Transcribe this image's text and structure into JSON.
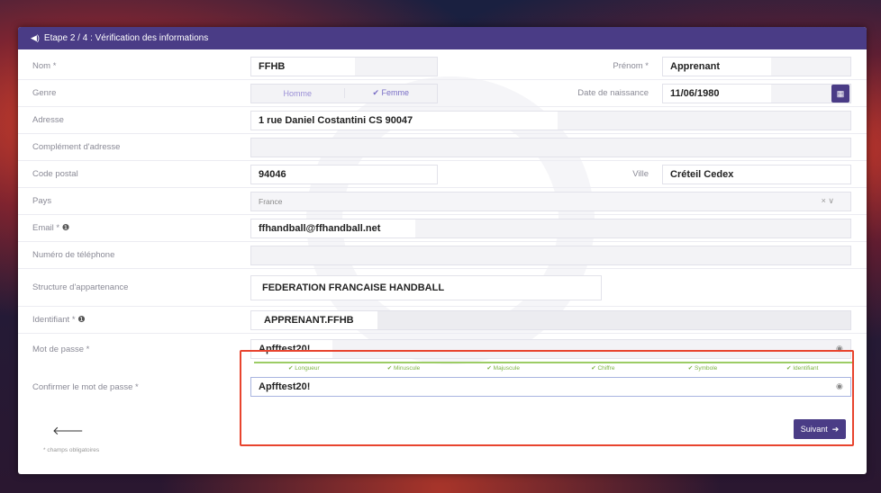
{
  "header": {
    "title": "Etape 2 / 4 : Vérification des informations"
  },
  "fields": {
    "nom": {
      "label": "Nom *",
      "value": "FFHB"
    },
    "prenom": {
      "label": "Prénom *",
      "value": "Apprenant"
    },
    "genre": {
      "label": "Genre",
      "options": [
        "Homme",
        "✔ Femme"
      ]
    },
    "naissance": {
      "label": "Date de naissance",
      "value": "11/06/1980"
    },
    "adresse": {
      "label": "Adresse",
      "value": "1 rue Daniel Costantini CS 90047"
    },
    "complement": {
      "label": "Complément d'adresse",
      "value": ""
    },
    "cp": {
      "label": "Code postal",
      "value": "94046"
    },
    "ville": {
      "label": "Ville",
      "value": "Créteil Cedex"
    },
    "pays": {
      "label": "Pays",
      "value": "France",
      "clear": "×",
      "chevron": "∨"
    },
    "email": {
      "label": "Email *",
      "value": "ffhandball@ffhandball.net"
    },
    "tel": {
      "label": "Numéro de téléphone",
      "value": ""
    },
    "structure": {
      "label": "Structure d'appartenance",
      "value": "FEDERATION FRANCAISE HANDBALL"
    },
    "identifiant": {
      "label": "Identifiant *",
      "value": "APPRENANT.FFHB"
    },
    "mdp": {
      "label": "Mot de passe *",
      "value": "Apfftest20!"
    },
    "mdp_confirm": {
      "label": "Confirmer le mot de passe *",
      "value": "Apfftest20!"
    }
  },
  "strength": [
    "✔ Longueur",
    "✔ Minuscule",
    "✔ Majuscule",
    "✔ Chiffre",
    "✔ Symbole",
    "✔ Identifiant"
  ],
  "buttons": {
    "next": "Suivant",
    "back_icon": "arrow-left-icon"
  },
  "footer": {
    "required_note": "* champs obligatoires"
  },
  "colors": {
    "primary": "#4a3c86",
    "highlight": "#e8442e",
    "success": "#7cb342"
  }
}
